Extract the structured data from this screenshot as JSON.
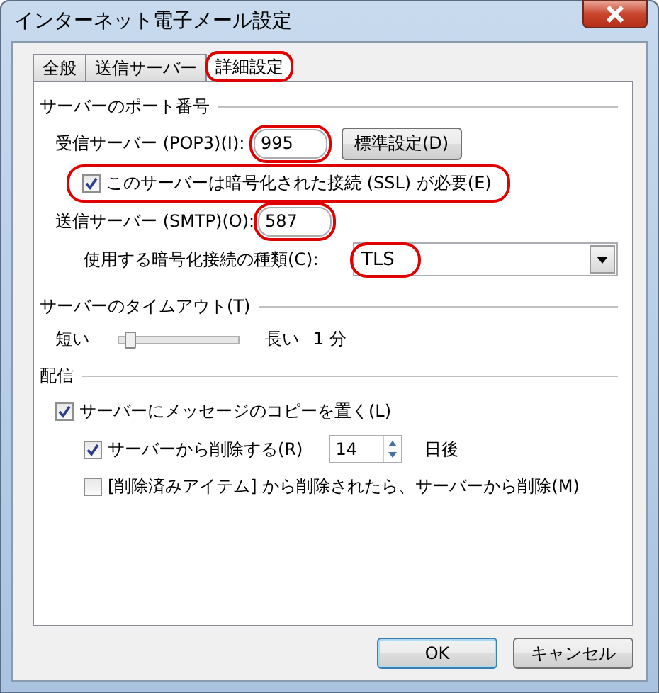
{
  "window": {
    "title": "インターネット電子メール設定"
  },
  "tabs": [
    {
      "label": "全般",
      "selected": false,
      "highlighted": false
    },
    {
      "label": "送信サーバー",
      "selected": false,
      "highlighted": false
    },
    {
      "label": "詳細設定",
      "selected": true,
      "highlighted": true
    }
  ],
  "port_section": {
    "heading": "サーバーのポート番号",
    "incoming": {
      "label": "受信サーバー (POP3)(I):",
      "value": "995",
      "highlighted": true
    },
    "default_button": "標準設定(D)",
    "ssl": {
      "label": "このサーバーは暗号化された接続 (SSL) が必要(E)",
      "checked": true,
      "highlighted": true
    },
    "outgoing": {
      "label": "送信サーバー (SMTP)(O):",
      "value": "587",
      "highlighted": true
    },
    "encryption": {
      "label": "使用する暗号化接続の種類(C):",
      "value": "TLS",
      "highlighted": true
    }
  },
  "timeout_section": {
    "heading": "サーバーのタイムアウト(T)",
    "short_label": "短い",
    "long_label": "長い",
    "reading": "1 分",
    "level": 0.05
  },
  "delivery_section": {
    "heading": "配信",
    "options": [
      {
        "label": "サーバーにメッセージのコピーを置く(L)",
        "checked": true,
        "children": [
          {
            "kind": "spin",
            "label": "サーバーから削除する(R)",
            "checked": true,
            "value": "14",
            "suffix": "日後"
          },
          {
            "kind": "checkbox",
            "label": "[削除済みアイテム] から削除されたら、サーバーから削除(M)",
            "checked": false
          }
        ]
      }
    ]
  },
  "buttons": [
    {
      "label": "OK",
      "default": true
    },
    {
      "label": "キャンセル",
      "default": false
    }
  ]
}
